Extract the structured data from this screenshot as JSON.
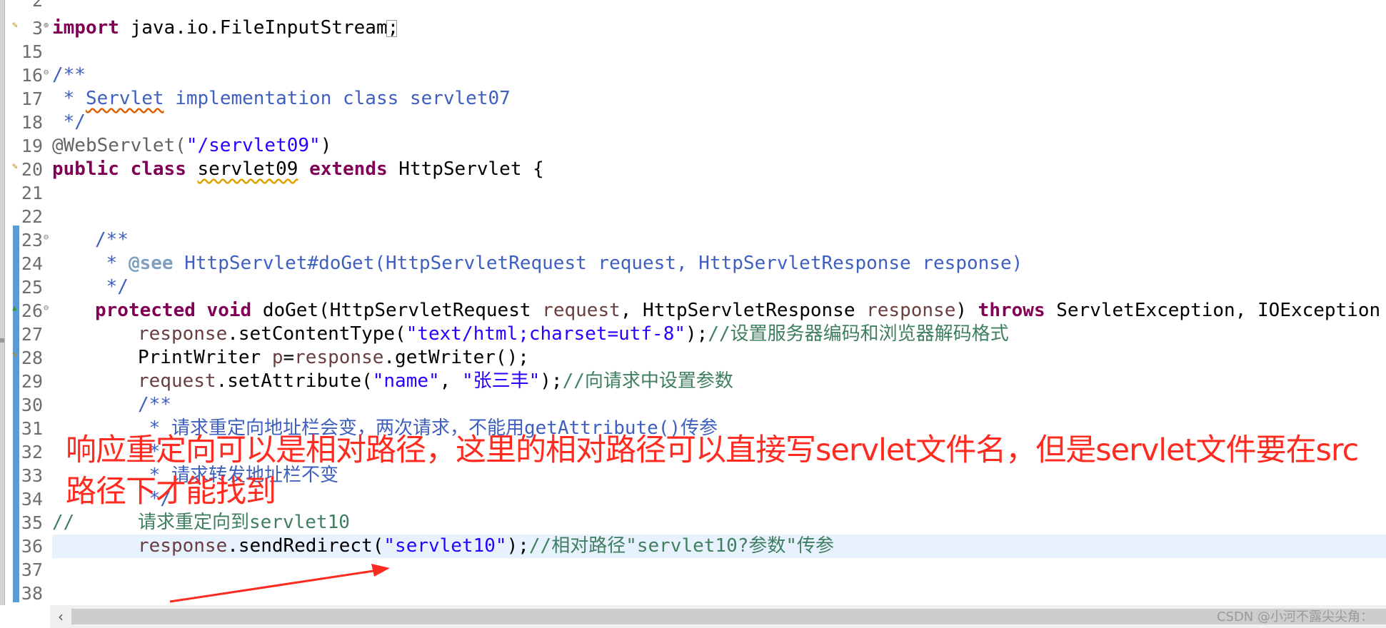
{
  "editor": {
    "top_partial_line": "2",
    "lines": [
      {
        "n": "3",
        "fold": "⊕",
        "marker": "warn",
        "code": "import_line"
      },
      {
        "n": "15"
      },
      {
        "n": "16",
        "fold": "⊖"
      },
      {
        "n": "17"
      },
      {
        "n": "18"
      },
      {
        "n": "19"
      },
      {
        "n": "20",
        "marker": "warn"
      },
      {
        "n": "21"
      },
      {
        "n": "22"
      },
      {
        "n": "23",
        "fold": "⊖"
      },
      {
        "n": "24"
      },
      {
        "n": "25"
      },
      {
        "n": "26",
        "fold": "⊖",
        "marker": "override"
      },
      {
        "n": "27"
      },
      {
        "n": "28",
        "marker": "warn"
      },
      {
        "n": "29"
      },
      {
        "n": "30"
      },
      {
        "n": "31"
      },
      {
        "n": "32"
      },
      {
        "n": "33"
      },
      {
        "n": "34"
      },
      {
        "n": "35"
      },
      {
        "n": "36",
        "current": true
      },
      {
        "n": "37"
      },
      {
        "n": "38"
      }
    ],
    "tokens": {
      "import": "import",
      "import_path": " java.io.FileInputStream;",
      "javadoc_open": "/**",
      "javadoc_star": " * ",
      "servlet_word": "Servlet",
      "javadoc_17_rest": " implementation class servlet07",
      "javadoc_close": " */",
      "annotation": "@WebServlet(",
      "annotation_str": "\"/servlet09\"",
      "annotation_close": ")",
      "public": "public",
      "class": "class",
      "class_name": "servlet09",
      "extends": "extends",
      "superclass": " HttpServlet {",
      "jd23": "/**",
      "jd24_star": " * ",
      "jd24_tag": "@see",
      "jd24_rest": " HttpServlet#doGet(HttpServletRequest request, HttpServletResponse response)",
      "jd25": " */",
      "protected": "protected",
      "void": "void",
      "m26_a": " doGet(HttpServletRequest ",
      "m26_req": "request",
      "m26_b": ", HttpServletResponse ",
      "m26_resp": "response",
      "m26_c": ") ",
      "throws": "throws",
      "m26_d": " ServletException, IOException {",
      "l27_var": "response",
      "l27_a": ".setContentType(",
      "l27_str": "\"text/html;charset=utf-8\"",
      "l27_b": ");",
      "l27_cm": "//设置服务器编码和浏览器解码格式",
      "l28_a": "PrintWriter ",
      "l28_p": "p",
      "l28_eq": "=",
      "l28_var": "response",
      "l28_b": ".getWriter();",
      "l29_var": "request",
      "l29_a": ".setAttribute(",
      "l29_s1": "\"name\"",
      "l29_b": ", ",
      "l29_s2": "\"张三丰\"",
      "l29_c": ");",
      "l29_cm": "//向请求中设置参数",
      "l30": "/**",
      "l31_star": " * ",
      "l31_text": "请求重定向地址栏会变，两次请求，不能用getAttribute()传参",
      "l32": " * ",
      "l33_star": " * ",
      "l33_text": "请求转发地址栏不变",
      "l34": " */",
      "l35_cm": "//",
      "l35_text": "请求重定向到servlet10",
      "l36_var": "response",
      "l36_a": ".sendRedirect(",
      "l36_str": "\"servlet10\"",
      "l36_b": ");",
      "l36_cm": "//相对路径\"servlet10?参数\"传参"
    }
  },
  "overlay": {
    "text": "响应重定向可以是相对路径，这里的相对路径可以直接写servlet文件名，但是servlet文件要在src路径下才能找到",
    "color": "#ff2a20"
  },
  "scrollbar": {
    "left_arrow": "‹"
  },
  "watermark": "CSDN @小河不露尖尖角："
}
